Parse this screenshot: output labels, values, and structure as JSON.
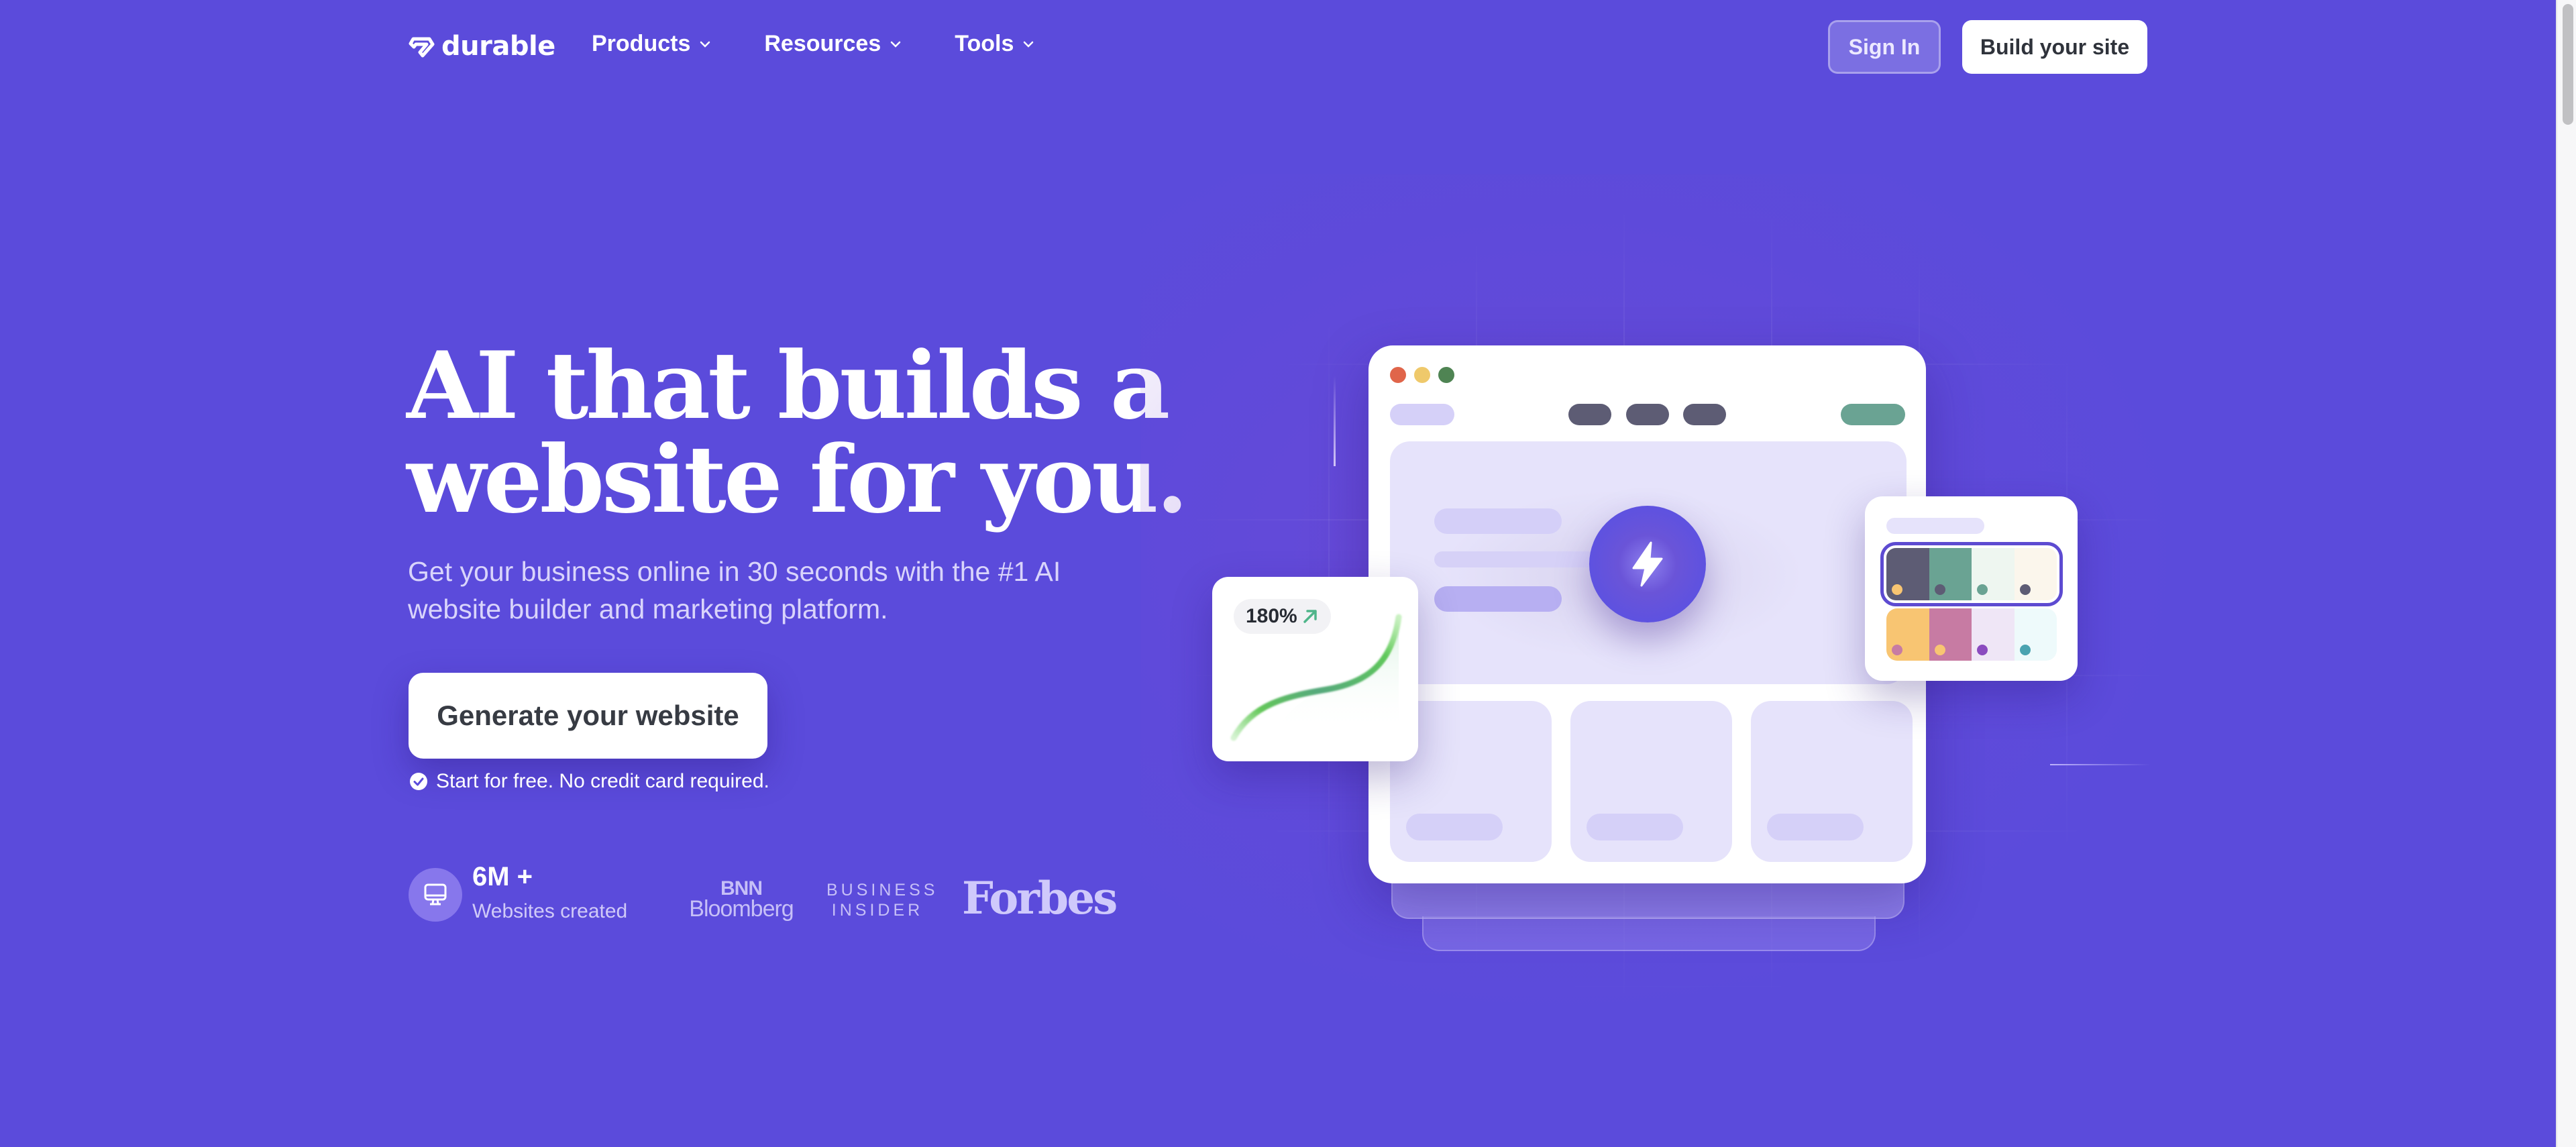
{
  "header": {
    "logo_text": "durable",
    "nav": [
      {
        "label": "Products",
        "icon": "chevron-down-icon"
      },
      {
        "label": "Resources",
        "icon": "chevron-down-icon"
      },
      {
        "label": "Tools",
        "icon": "chevron-down-icon"
      }
    ],
    "sign_in_label": "Sign In",
    "build_site_label": "Build your site"
  },
  "hero": {
    "headline_line1": "AI that builds a",
    "headline_line2": "website for you.",
    "subheadline": "Get your business online in 30 seconds with the #1 AI website builder and marketing platform.",
    "cta_label": "Generate your website",
    "note": "Start for free. No credit card required.",
    "note_icon": "check-circle-icon"
  },
  "stats": {
    "icon": "monitor-icon",
    "value": "6M +",
    "label": "Websites created"
  },
  "press": {
    "bnn_line1": "BNN",
    "bnn_line2": "Bloomberg",
    "business_insider_line1": "BUSINESS",
    "business_insider_line2": "INSIDER",
    "forbes": "Forbes"
  },
  "illustration": {
    "window_dots": [
      "#e0654a",
      "#efc96b",
      "#4f8453"
    ],
    "growth_badge": "180%",
    "growth_icon": "arrow-up-right-icon",
    "accent_green": "#4fb58a",
    "palette_rows": [
      {
        "selected": true,
        "swatches": [
          {
            "color": "#5d5c74",
            "dot": "#f8c572"
          },
          {
            "color": "#6aa393",
            "dot": "#5d5c74"
          },
          {
            "color": "#eef6f0",
            "dot": "#6aa393"
          },
          {
            "color": "#fbf6ec",
            "dot": "#5d5c74"
          }
        ]
      },
      {
        "selected": false,
        "swatches": [
          {
            "color": "#f8c572",
            "dot": "#c77ba3"
          },
          {
            "color": "#c77ba3",
            "dot": "#f8c572"
          },
          {
            "color": "#efe6f6",
            "dot": "#8b4bbf"
          },
          {
            "color": "#eefafb",
            "dot": "#4aa3b0"
          }
        ]
      }
    ]
  },
  "colors": {
    "background": "#5b4bdb",
    "primary_dark": "#373b43",
    "accent_purple": "#5d4bd1"
  }
}
